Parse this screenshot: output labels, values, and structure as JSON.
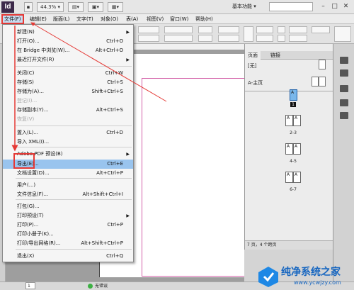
{
  "app": {
    "logo": "Id",
    "zoom": "44.3%",
    "workspace": "基本功能"
  },
  "menubar": {
    "items": [
      "文件(F)",
      "编辑(E)",
      "版面(L)",
      "文字(T)",
      "对象(O)",
      "表(A)",
      "视图(V)",
      "窗口(W)",
      "帮助(H)"
    ]
  },
  "file_menu": {
    "items": [
      {
        "label": "新建(N)",
        "shortcut": "",
        "submenu": true,
        "disabled": false
      },
      {
        "label": "打开(O)...",
        "shortcut": "Ctrl+O",
        "submenu": false,
        "disabled": false
      },
      {
        "label": "在 Bridge 中浏览(W)...",
        "shortcut": "Alt+Ctrl+O",
        "submenu": false,
        "disabled": false
      },
      {
        "label": "最近打开文件(R)",
        "shortcut": "",
        "submenu": true,
        "disabled": false
      },
      {
        "label": "关闭(C)",
        "shortcut": "Ctrl+W",
        "submenu": false,
        "disabled": false
      },
      {
        "label": "存储(S)",
        "shortcut": "Ctrl+S",
        "submenu": false,
        "disabled": false
      },
      {
        "label": "存储为(A)...",
        "shortcut": "Shift+Ctrl+S",
        "submenu": false,
        "disabled": false
      },
      {
        "label": "登记(I)...",
        "shortcut": "",
        "submenu": false,
        "disabled": true
      },
      {
        "label": "存储副本(Y)...",
        "shortcut": "Alt+Ctrl+S",
        "submenu": false,
        "disabled": false
      },
      {
        "label": "恢复(V)",
        "shortcut": "",
        "submenu": false,
        "disabled": true
      },
      {
        "label": "置入(L)...",
        "shortcut": "Ctrl+D",
        "submenu": false,
        "disabled": false
      },
      {
        "label": "导入 XML(I)...",
        "shortcut": "",
        "submenu": false,
        "disabled": false
      },
      {
        "label": "Adobe PDF 预设(B)",
        "shortcut": "",
        "submenu": true,
        "disabled": false
      },
      {
        "label": "导出(E)...",
        "shortcut": "Ctrl+E",
        "submenu": false,
        "disabled": false,
        "highlighted": true
      },
      {
        "label": "文档设置(D)...",
        "shortcut": "Alt+Ctrl+P",
        "submenu": false,
        "disabled": false
      },
      {
        "label": "用户(...)",
        "shortcut": "",
        "submenu": false,
        "disabled": false
      },
      {
        "label": "文件信息(F)...",
        "shortcut": "Alt+Shift+Ctrl+I",
        "submenu": false,
        "disabled": false
      },
      {
        "label": "打包(G)...",
        "shortcut": "",
        "submenu": false,
        "disabled": false
      },
      {
        "label": "打印预设(T)",
        "shortcut": "",
        "submenu": true,
        "disabled": false
      },
      {
        "label": "打印(P)...",
        "shortcut": "Ctrl+P",
        "submenu": false,
        "disabled": false
      },
      {
        "label": "打印小册子(K)...",
        "shortcut": "",
        "submenu": false,
        "disabled": false
      },
      {
        "label": "打印/导出网格(R)...",
        "shortcut": "Alt+Shift+Ctrl+P",
        "submenu": false,
        "disabled": false
      },
      {
        "label": "退出(X)",
        "shortcut": "Ctrl+Q",
        "submenu": false,
        "disabled": false
      }
    ]
  },
  "pages_panel": {
    "tabs": [
      "页面",
      "链接"
    ],
    "master_none": "[无]",
    "master_a": "A-主页",
    "page_labels": [
      "1",
      "2-3",
      "4-5",
      "6-7"
    ],
    "thumb_letter": "A",
    "footer": "7 页，4 个跨页"
  },
  "status": {
    "page_field": "1",
    "errors": "无错误"
  },
  "watermark": {
    "title": "纯净系统之家",
    "url": "www.ycwjzy.com"
  }
}
